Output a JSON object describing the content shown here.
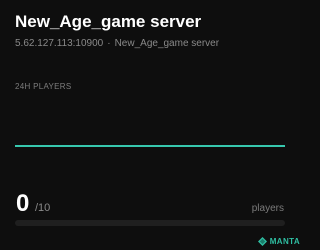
{
  "server": {
    "name": "New_Age_game server",
    "address": "5.62.127.113:10900",
    "separator": "·",
    "subtitle_name": "New_Age_game server"
  },
  "graph": {
    "label": "24H PLAYERS",
    "line_color": "#37c8ae",
    "values": [
      0,
      0
    ]
  },
  "players": {
    "current": "0",
    "max": "/10",
    "unit": "players",
    "fill_fraction": 0,
    "fill_color": "#37c8ae"
  },
  "brand": {
    "text": "MANTA",
    "icon": "manta-diamond-icon",
    "color": "#2fbfa3"
  }
}
